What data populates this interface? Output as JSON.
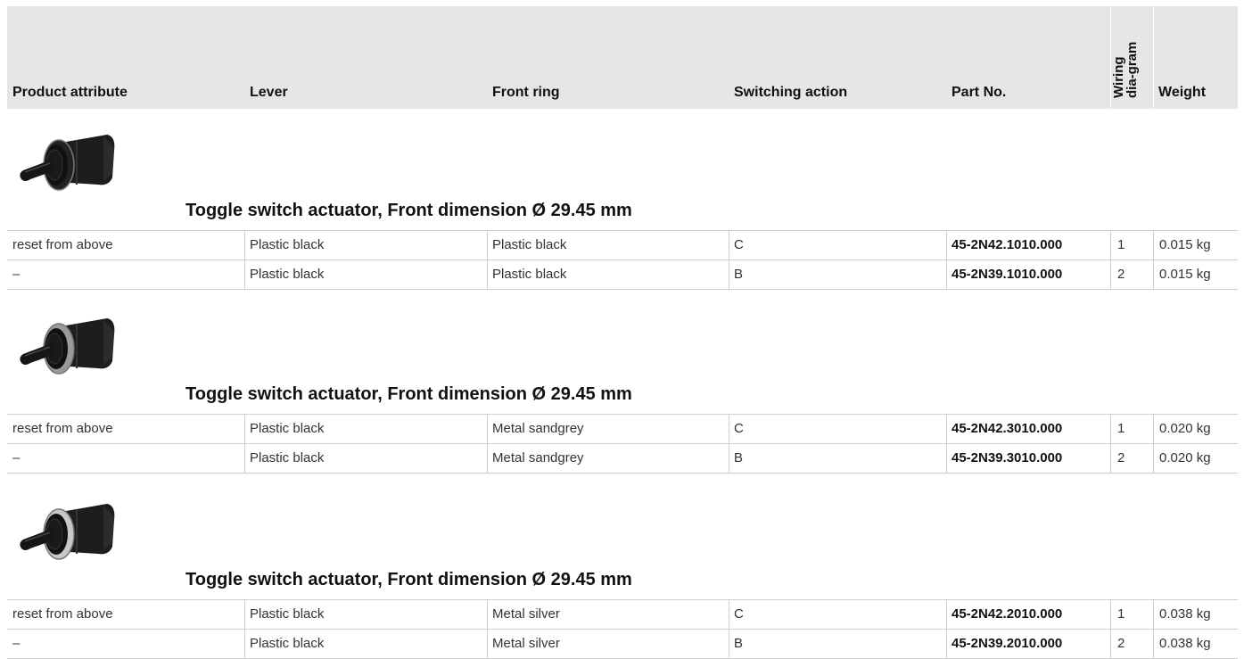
{
  "headers": {
    "product_attribute": "Product attribute",
    "lever": "Lever",
    "front_ring": "Front ring",
    "switching_action": "Switching action",
    "part_no": "Part No.",
    "wiring_diagram": "Wiring dia-gram",
    "weight": "Weight"
  },
  "groups": [
    {
      "title": "Toggle switch actuator, Front dimension Ø 29.45 mm",
      "ring_color": "#222222",
      "rows": [
        {
          "attribute": "reset from above",
          "lever": "Plastic black",
          "front_ring": "Plastic black",
          "switching_action": "C",
          "part_no": "45-2N42.1010.000",
          "wiring": "1",
          "weight": "0.015 kg"
        },
        {
          "attribute": "–",
          "lever": "Plastic black",
          "front_ring": "Plastic black",
          "switching_action": "B",
          "part_no": "45-2N39.1010.000",
          "wiring": "2",
          "weight": "0.015 kg"
        }
      ]
    },
    {
      "title": "Toggle switch actuator, Front dimension Ø 29.45 mm",
      "ring_color": "#9a9a9a",
      "rows": [
        {
          "attribute": "reset from above",
          "lever": "Plastic black",
          "front_ring": "Metal sandgrey",
          "switching_action": "C",
          "part_no": "45-2N42.3010.000",
          "wiring": "1",
          "weight": "0.020 kg"
        },
        {
          "attribute": "–",
          "lever": "Plastic black",
          "front_ring": "Metal sandgrey",
          "switching_action": "B",
          "part_no": "45-2N39.3010.000",
          "wiring": "2",
          "weight": "0.020 kg"
        }
      ]
    },
    {
      "title": "Toggle switch actuator, Front dimension Ø 29.45 mm",
      "ring_color": "#c8c8c8",
      "rows": [
        {
          "attribute": "reset from above",
          "lever": "Plastic black",
          "front_ring": "Metal silver",
          "switching_action": "C",
          "part_no": "45-2N42.2010.000",
          "wiring": "1",
          "weight": "0.038 kg"
        },
        {
          "attribute": "–",
          "lever": "Plastic black",
          "front_ring": "Metal silver",
          "switching_action": "B",
          "part_no": "45-2N39.2010.000",
          "wiring": "2",
          "weight": "0.038 kg"
        }
      ]
    }
  ]
}
